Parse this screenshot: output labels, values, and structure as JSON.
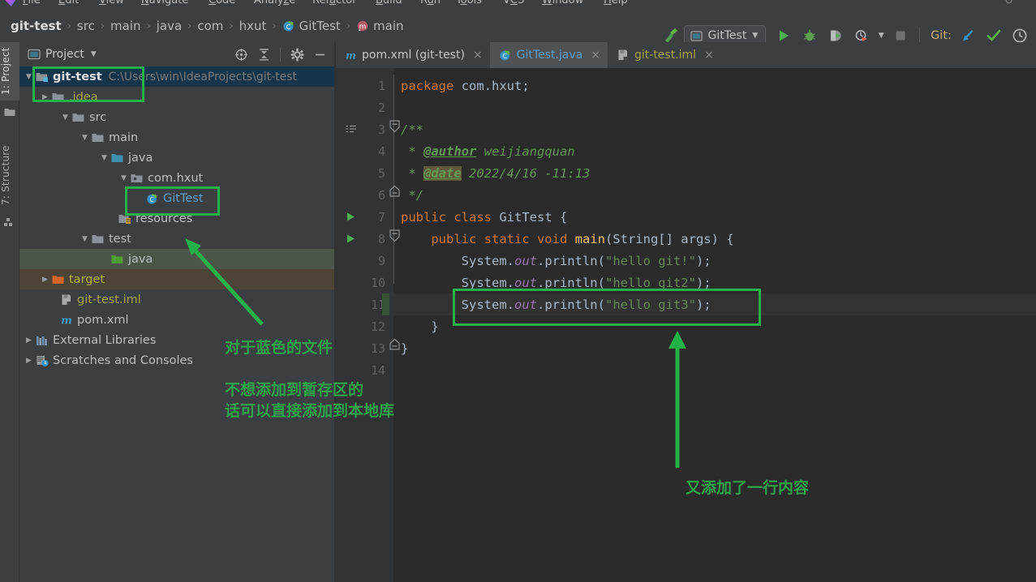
{
  "menu": {
    "items": [
      "File",
      "Edit",
      "View",
      "Navigate",
      "Code",
      "Analyze",
      "Refactor",
      "Build",
      "Run",
      "Tools",
      "VCS",
      "Window",
      "Help"
    ]
  },
  "breadcrumb": {
    "items": [
      {
        "label": "git-test",
        "icon": "none"
      },
      {
        "label": "src",
        "icon": "none"
      },
      {
        "label": "main",
        "icon": "none"
      },
      {
        "label": "java",
        "icon": "none"
      },
      {
        "label": "com",
        "icon": "none"
      },
      {
        "label": "hxut",
        "icon": "none"
      },
      {
        "label": "GitTest",
        "icon": "class-icon"
      },
      {
        "label": "main",
        "icon": "method-icon"
      }
    ],
    "separator": "›"
  },
  "toolbar": {
    "build_label": "build-hammer-icon",
    "run_config": "GitTest",
    "run_config_caret": "▼",
    "buttons": [
      {
        "name": "run-button",
        "icon": "run-icon"
      },
      {
        "name": "debug-button",
        "icon": "debug-icon"
      },
      {
        "name": "run-with-coverage-button",
        "icon": "coverage-icon"
      },
      {
        "name": "profile-button",
        "icon": "profile-icon"
      },
      {
        "name": "profile-dropdown",
        "icon": "chevron-down-icon"
      },
      {
        "name": "stop-button",
        "icon": "stop-icon"
      }
    ],
    "git_label": "Git:",
    "git_buttons": [
      {
        "name": "git-update-button",
        "icon": "update-arrow-icon",
        "color": "#3592c4"
      },
      {
        "name": "git-commit-button",
        "icon": "check-icon",
        "color": "#62b543"
      },
      {
        "name": "git-history-button",
        "icon": "clock-icon",
        "color": "#b0b3b5"
      }
    ]
  },
  "tool_strip": {
    "tabs": [
      {
        "label": "1: Project",
        "active": true
      },
      {
        "label": "7: Structure",
        "active": false
      }
    ]
  },
  "project_panel": {
    "title": "Project",
    "caret": "▼",
    "tools": [
      {
        "name": "select-opened-file-icon"
      },
      {
        "name": "collapse-all-icon"
      },
      {
        "name": "settings-gear-icon"
      },
      {
        "name": "hide-panel-icon"
      }
    ],
    "tree": [
      {
        "label": "git-test",
        "path": "C:\\Users\\win\\IdeaProjects\\git-test",
        "twisty": "▼",
        "indent": 0,
        "icon": "module-folder-icon",
        "style": "bold",
        "state": "selected"
      },
      {
        "label": ".idea",
        "twisty": "▶",
        "indent": 1,
        "icon": "folder-icon",
        "style": "olive",
        "state": "none"
      },
      {
        "label": "src",
        "twisty": "▼",
        "indent": 1,
        "icon": "folder-icon",
        "style": "normal",
        "state": "none"
      },
      {
        "label": "main",
        "twisty": "▼",
        "indent": 2,
        "icon": "folder-icon",
        "style": "normal",
        "state": "none"
      },
      {
        "label": "java",
        "twisty": "▼",
        "indent": 3,
        "icon": "source-folder-icon",
        "style": "normal",
        "state": "none"
      },
      {
        "label": "com.hxut",
        "twisty": "▼",
        "indent": 4,
        "icon": "package-icon",
        "style": "normal",
        "state": "none"
      },
      {
        "label": "GitTest",
        "twisty": "",
        "indent": 5,
        "icon": "class-icon",
        "style": "blue",
        "state": "none"
      },
      {
        "label": "resources",
        "twisty": "",
        "indent": 4,
        "icon": "resources-folder-icon",
        "style": "normal",
        "state": "none"
      },
      {
        "label": "test",
        "twisty": "▼",
        "indent": 2,
        "icon": "folder-icon",
        "style": "normal",
        "state": "none"
      },
      {
        "label": "java",
        "twisty": "",
        "indent": 3,
        "icon": "test-source-folder-icon",
        "style": "normal",
        "state": "green-highlight"
      },
      {
        "label": "target",
        "twisty": "▶",
        "indent": 1,
        "icon": "excluded-folder-icon",
        "style": "olive",
        "state": "brown-highlight"
      },
      {
        "label": "git-test.iml",
        "twisty": "",
        "indent": 2,
        "icon": "iml-file-icon",
        "style": "olive",
        "state": "none"
      },
      {
        "label": "pom.xml",
        "twisty": "",
        "indent": 2,
        "icon": "maven-icon",
        "style": "normal",
        "state": "none"
      },
      {
        "label": "External Libraries",
        "twisty": "▶",
        "indent": 0,
        "icon": "libraries-icon",
        "style": "normal",
        "state": "none"
      },
      {
        "label": "Scratches and Consoles",
        "twisty": "▶",
        "indent": 0,
        "icon": "scratches-icon",
        "style": "normal",
        "state": "none"
      }
    ]
  },
  "editor": {
    "tabs": [
      {
        "label": "pom.xml (git-test)",
        "icon": "maven-icon",
        "style": "normal",
        "active": false,
        "close": "×"
      },
      {
        "label": "GitTest.java",
        "icon": "class-icon",
        "style": "blue",
        "active": true,
        "close": "×"
      },
      {
        "label": "git-test.iml",
        "icon": "iml-file-icon",
        "style": "olive",
        "active": false,
        "close": "×"
      }
    ],
    "lines": [
      {
        "n": "1",
        "tokens": [
          {
            "t": "package",
            "c": "kw"
          },
          {
            "t": " com.hxut;",
            "c": "plain"
          }
        ]
      },
      {
        "n": "2",
        "tokens": []
      },
      {
        "n": "3",
        "tokens": [
          {
            "t": "/**",
            "c": "cmt"
          }
        ],
        "gutter_icon": "doc-icon",
        "fold": "fold-open-top"
      },
      {
        "n": "4",
        "tokens": [
          {
            "t": " * ",
            "c": "cmt"
          },
          {
            "t": "@author",
            "c": "tag"
          },
          {
            "t": " weijiangquan",
            "c": "cmt"
          }
        ]
      },
      {
        "n": "5",
        "tokens": [
          {
            "t": " * ",
            "c": "cmt"
          },
          {
            "t": "@date",
            "c": "tag-hl"
          },
          {
            "t": " 2022/4/16 -11:13",
            "c": "cmt"
          }
        ]
      },
      {
        "n": "6",
        "tokens": [
          {
            "t": " */",
            "c": "cmt"
          }
        ],
        "fold": "fold-end"
      },
      {
        "n": "7",
        "tokens": [
          {
            "t": "public class ",
            "c": "kw"
          },
          {
            "t": "GitTest {",
            "c": "plain"
          }
        ],
        "gutter_icon": "run-gutter-icon"
      },
      {
        "n": "8",
        "tokens": [
          {
            "t": "    ",
            "c": "plain"
          },
          {
            "t": "public static void ",
            "c": "kw"
          },
          {
            "t": "main",
            "c": "mth"
          },
          {
            "t": "(String[] args) {",
            "c": "plain"
          }
        ],
        "gutter_icon": "run-gutter-icon",
        "fold": "fold-open"
      },
      {
        "n": "9",
        "tokens": [
          {
            "t": "        System.",
            "c": "plain"
          },
          {
            "t": "out",
            "c": "fld"
          },
          {
            "t": ".println(",
            "c": "plain"
          },
          {
            "t": "\"hello git!\"",
            "c": "str"
          },
          {
            "t": ");",
            "c": "plain"
          }
        ]
      },
      {
        "n": "10",
        "tokens": [
          {
            "t": "        System.",
            "c": "plain"
          },
          {
            "t": "out",
            "c": "fld"
          },
          {
            "t": ".println(",
            "c": "plain"
          },
          {
            "t": "\"hello git2\"",
            "c": "str"
          },
          {
            "t": ");",
            "c": "plain"
          }
        ]
      },
      {
        "n": "11",
        "tokens": [
          {
            "t": "        System.",
            "c": "plain"
          },
          {
            "t": "out",
            "c": "fld"
          },
          {
            "t": ".println(",
            "c": "plain"
          },
          {
            "t": "\"hello git3\"",
            "c": "str"
          },
          {
            "t": ");",
            "c": "plain"
          }
        ],
        "current": true,
        "changed": true
      },
      {
        "n": "12",
        "tokens": [
          {
            "t": "    }",
            "c": "plain"
          }
        ],
        "fold": "fold-end"
      },
      {
        "n": "13",
        "tokens": [
          {
            "t": "}",
            "c": "plain"
          }
        ]
      },
      {
        "n": "14",
        "tokens": []
      }
    ]
  },
  "annotations": {
    "box_project_root": "highlight-box-project-root",
    "box_gittest_node": "highlight-box-gittest-node",
    "box_code_line_11": "highlight-box-code-line-11",
    "arrow_to_tree": "arrow-pointing-to-tree",
    "arrow_to_code": "arrow-pointing-to-code-line",
    "note_blue_file": "对于蓝色的文件",
    "note_staging_line1": "不想添加到暂存区的",
    "note_staging_line2": "话可以直接添加到本地库",
    "note_added_line": "又添加了一行内容"
  }
}
